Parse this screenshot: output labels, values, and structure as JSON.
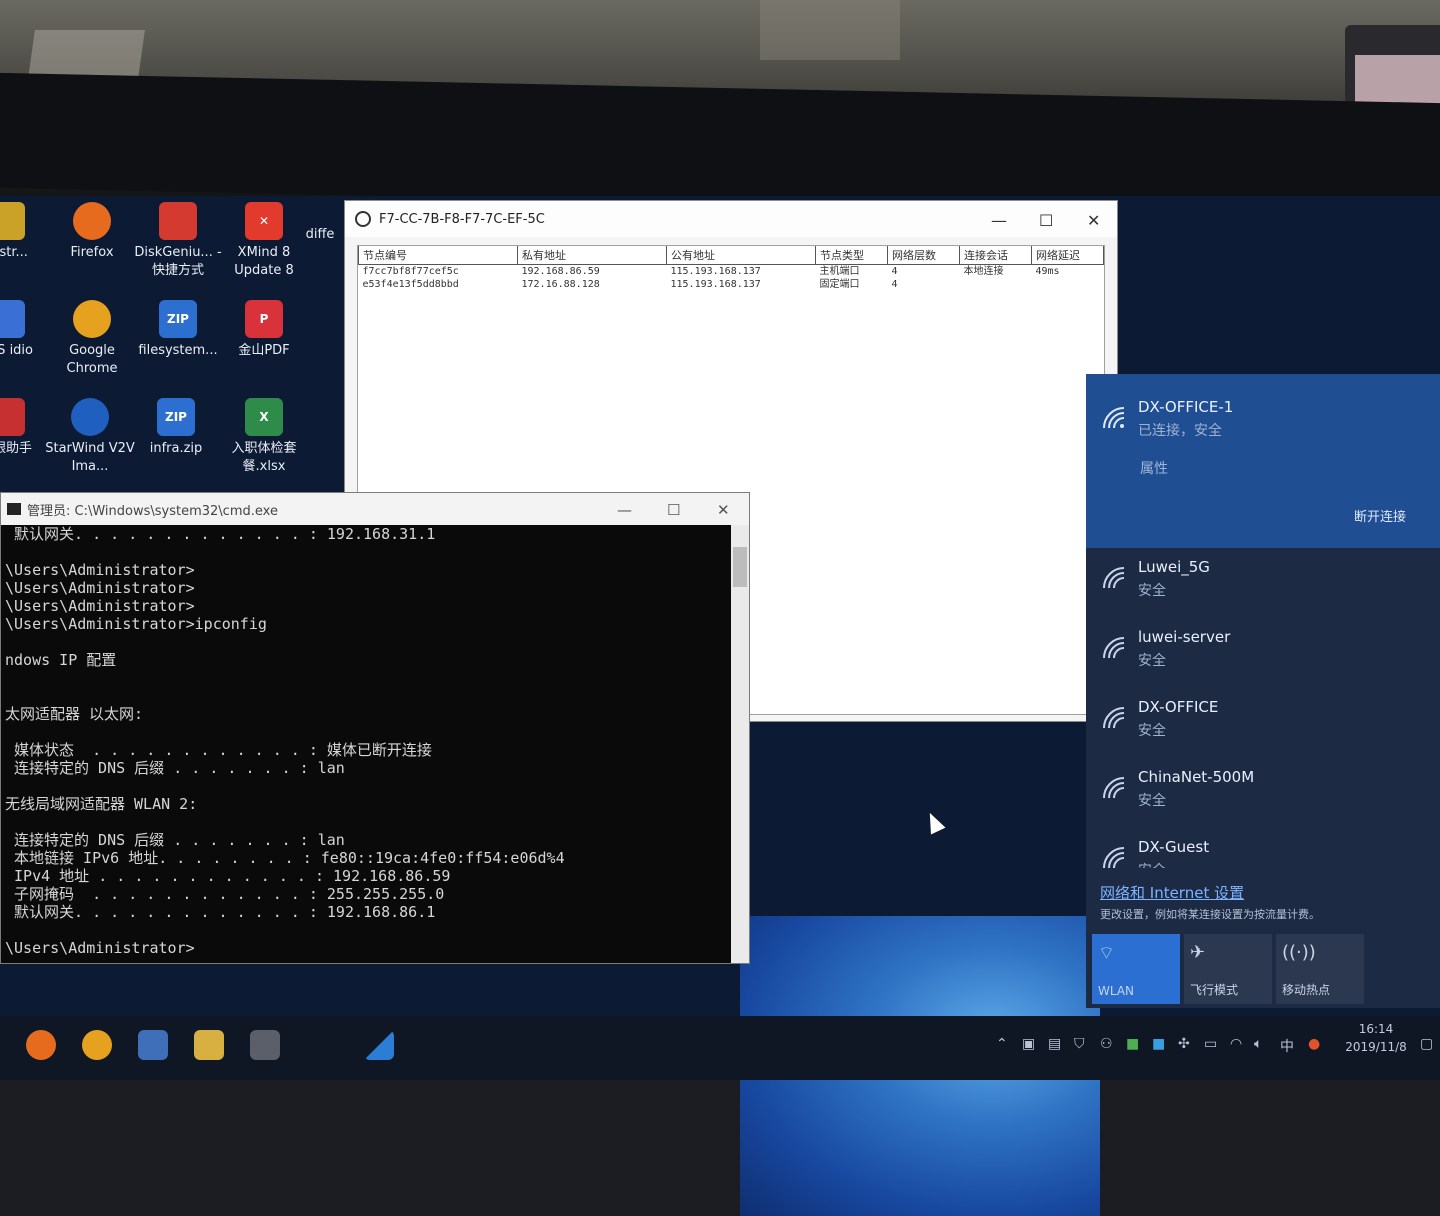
{
  "desktop": {
    "icons": [
      {
        "label": "inistr...",
        "color": "#c9a227"
      },
      {
        "label": "Firefox",
        "color": "#e66b1f"
      },
      {
        "label": "DiskGeniu... - 快捷方式",
        "color": "#d43a2f"
      },
      {
        "label": "XMind 8 Update 8",
        "color": "#e23b2e"
      },
      {
        "label": "diffe",
        "color": "#4a4a4a"
      },
      {
        "label": "oOS idio",
        "color": "#3a6fd6"
      },
      {
        "label": "Google Chrome",
        "color": "#e6a21f"
      },
      {
        "label": "filesystem...",
        "color": "#2c6fd0"
      },
      {
        "label": "金山PDF",
        "color": "#d8323a"
      },
      {
        "label": "网银助手",
        "color": "#c73030"
      },
      {
        "label": "StarWind V2V Ima...",
        "color": "#1f5fbf"
      },
      {
        "label": "infra.zip",
        "color": "#2c6fd0"
      },
      {
        "label": "入职体检套餐.xlsx",
        "color": "#2e8b4a"
      }
    ]
  },
  "peer_window": {
    "title": "F7-CC-7B-F8-F7-7C-EF-5C",
    "columns": [
      "节点编号",
      "私有地址",
      "公有地址",
      "节点类型",
      "网络层数",
      "连接会话",
      "网络延迟"
    ],
    "rows": [
      {
        "id": "f7cc7bf8f77cef5c",
        "private": "192.168.86.59",
        "public": "115.193.168.137",
        "type": "主机端口",
        "layers": "4",
        "session": "本地连接",
        "latency": "49ms"
      },
      {
        "id": "e53f4e13f5dd8bbd",
        "private": "172.16.88.128",
        "public": "115.193.168.137",
        "type": "固定端口",
        "layers": "4",
        "session": "",
        "latency": ""
      }
    ]
  },
  "cmd_window": {
    "title": "管理员: C:\\Windows\\system32\\cmd.exe",
    "lines": [
      " 默认网关. . . . . . . . . . . . . : 192.168.31.1",
      "",
      "\\Users\\Administrator>",
      "\\Users\\Administrator>",
      "\\Users\\Administrator>",
      "\\Users\\Administrator>ipconfig",
      "",
      "ndows IP 配置",
      "",
      "",
      "太网适配器 以太网:",
      "",
      " 媒体状态  . . . . . . . . . . . . : 媒体已断开连接",
      " 连接特定的 DNS 后缀 . . . . . . . : lan",
      "",
      "无线局域网适配器 WLAN 2:",
      "",
      " 连接特定的 DNS 后缀 . . . . . . . : lan",
      " 本地链接 IPv6 地址. . . . . . . . : fe80::19ca:4fe0:ff54:e06d%4",
      " IPv4 地址 . . . . . . . . . . . . : 192.168.86.59",
      " 子网掩码  . . . . . . . . . . . . : 255.255.255.0",
      " 默认网关. . . . . . . . . . . . . : 192.168.86.1",
      "",
      "\\Users\\Administrator>"
    ]
  },
  "wifi": {
    "active": {
      "name": "DX-OFFICE-1",
      "status": "已连接，安全",
      "properties": "属性",
      "disconnect": "断开连接"
    },
    "networks": [
      {
        "name": "Luwei_5G",
        "status": "安全"
      },
      {
        "name": "luwei-server",
        "status": "安全"
      },
      {
        "name": "DX-OFFICE",
        "status": "安全"
      },
      {
        "name": "ChinaNet-500M",
        "status": "安全"
      },
      {
        "name": "DX-Guest",
        "status": "安全"
      }
    ],
    "settings_link": "网络和 Internet 设置",
    "settings_sub": "更改设置，例如将某连接设置为按流量计费。",
    "quick_actions": [
      {
        "label": "WLAN",
        "icon": "wifi-icon",
        "active": true
      },
      {
        "label": "飞行模式",
        "icon": "airplane-icon",
        "active": false
      },
      {
        "label": "移动热点",
        "icon": "hotspot-icon",
        "active": false
      }
    ]
  },
  "taskbar": {
    "ime": "中",
    "time": "16:14",
    "date": "2019/11/8"
  }
}
